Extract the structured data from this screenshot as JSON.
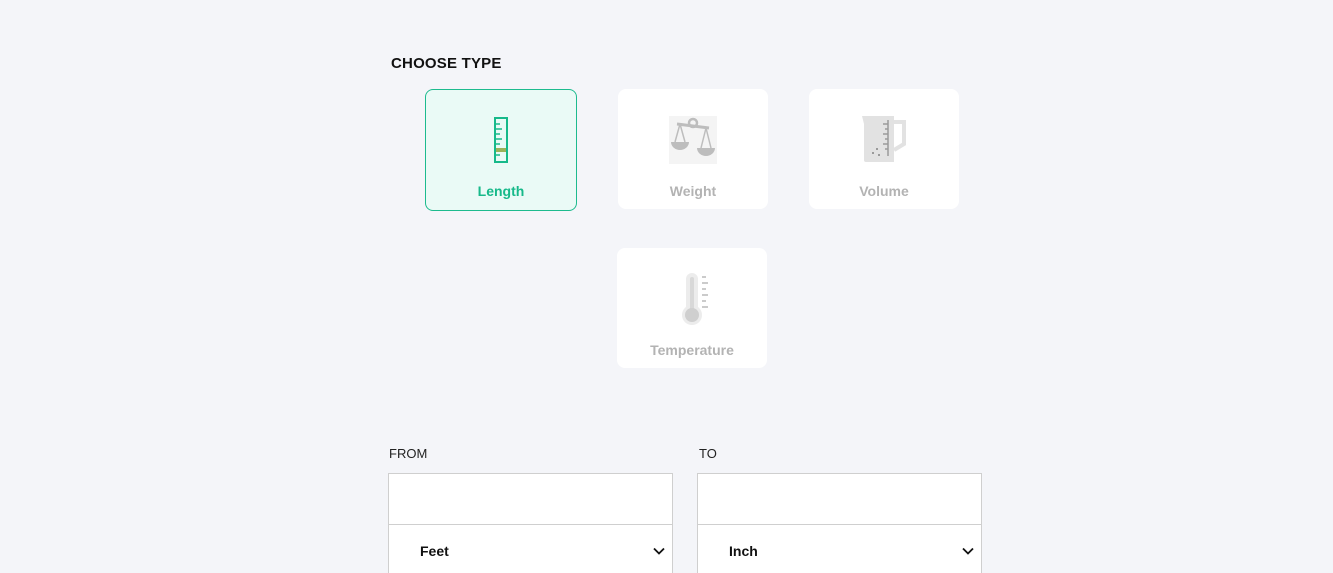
{
  "section_title": "CHOOSE TYPE",
  "types": [
    {
      "label": "Length",
      "icon": "ruler-icon",
      "selected": true
    },
    {
      "label": "Weight",
      "icon": "scale-icon",
      "selected": false
    },
    {
      "label": "Volume",
      "icon": "measuring-jug-icon",
      "selected": false
    },
    {
      "label": "Temperature",
      "icon": "thermometer-icon",
      "selected": false
    }
  ],
  "converter": {
    "from": {
      "label": "FROM",
      "value": "",
      "unit": "Feet"
    },
    "to": {
      "label": "TO",
      "value": "",
      "unit": "Inch"
    }
  },
  "colors": {
    "accent": "#17b98a",
    "selected_bg": "#eafaf6",
    "inactive_text": "#b3b3b3",
    "page_bg": "#f4f5f9"
  }
}
